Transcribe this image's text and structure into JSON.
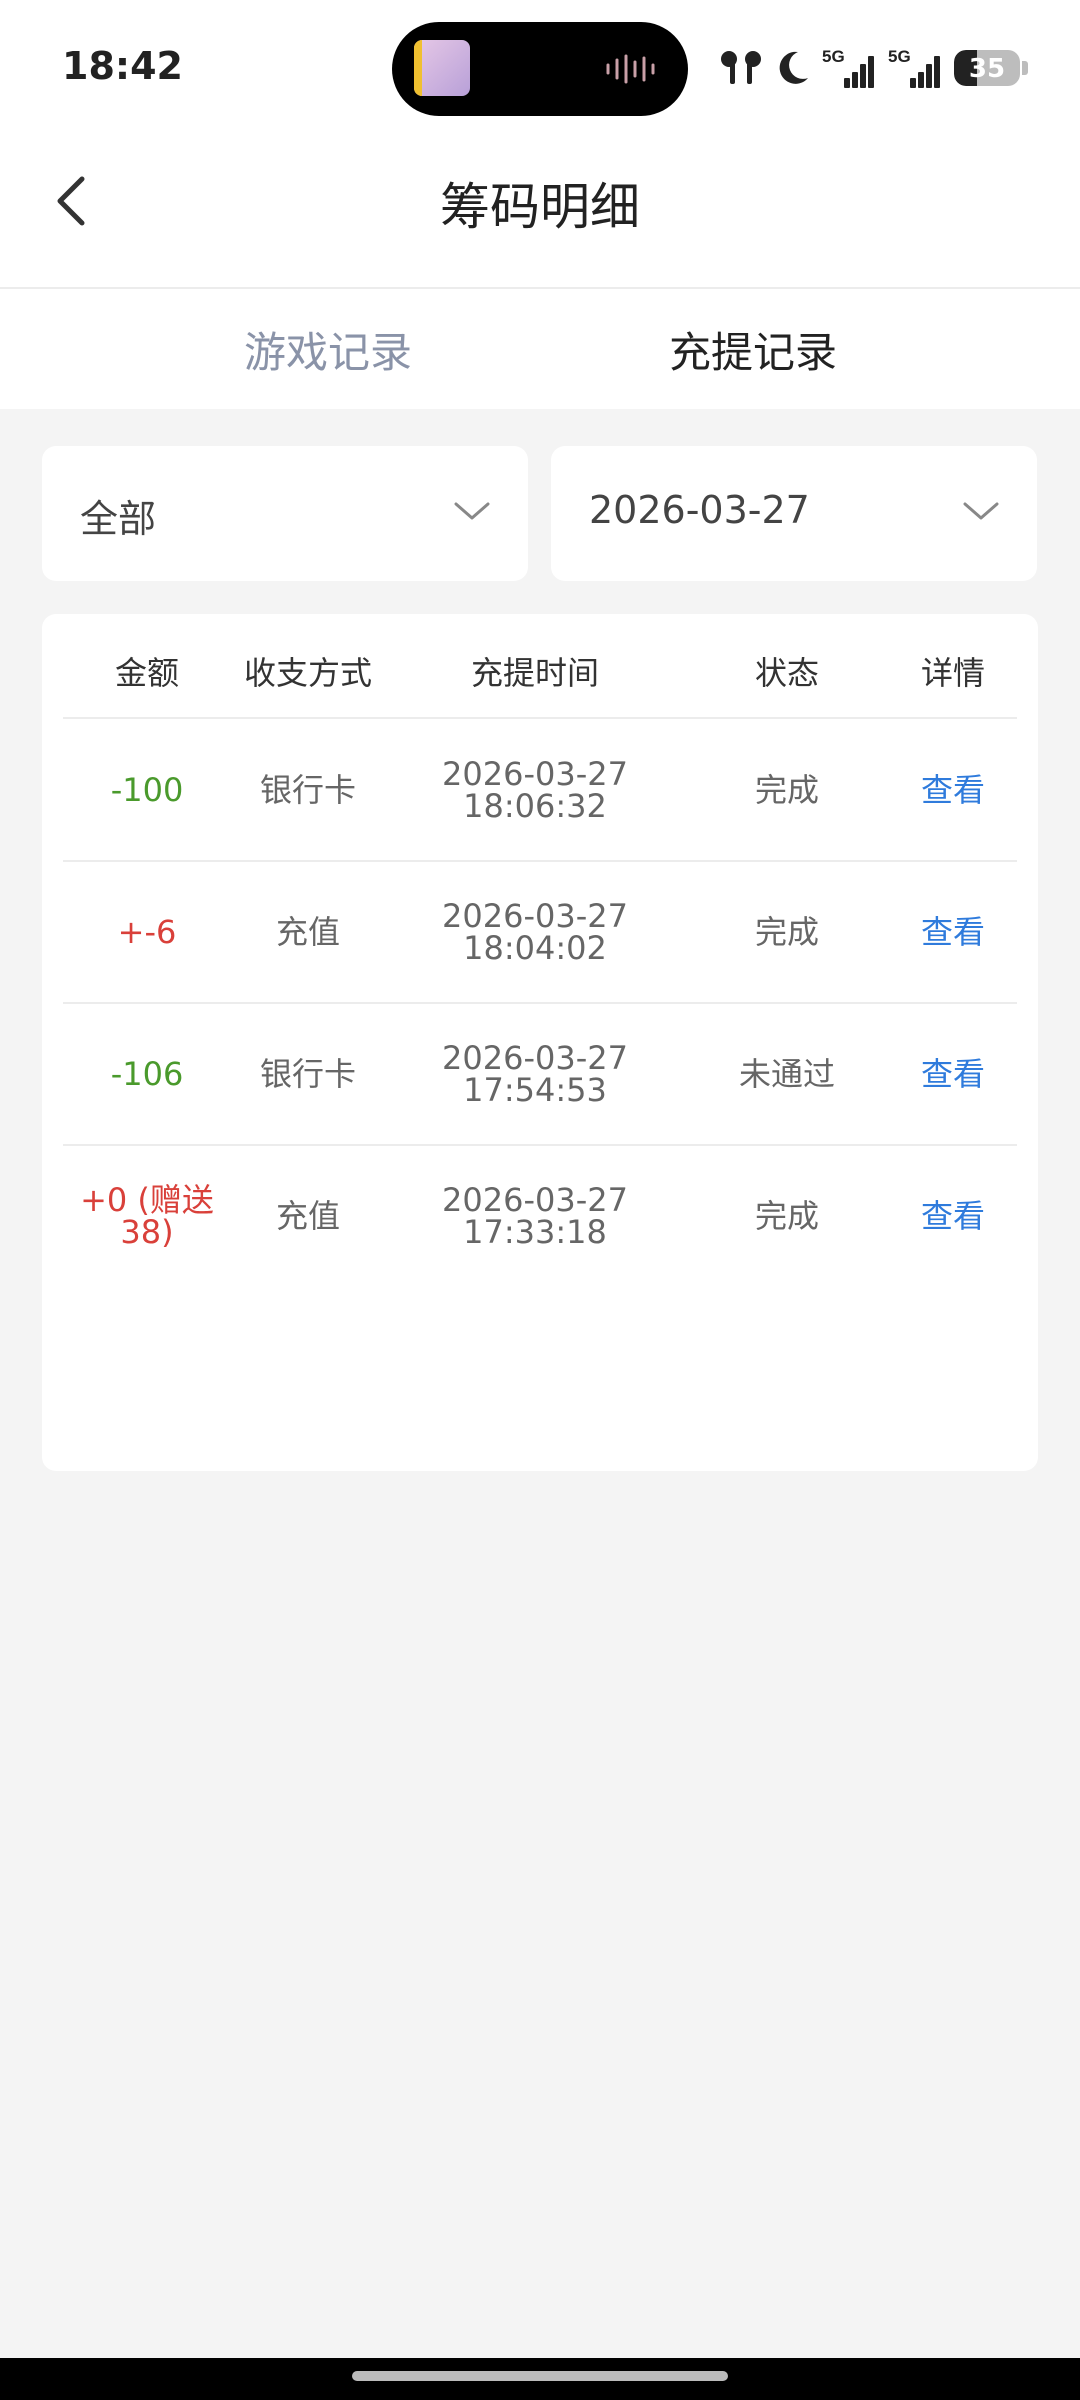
{
  "status_bar": {
    "time": "18:42",
    "signal_label_1": "5G",
    "signal_label_2": "5G",
    "battery_level": "35",
    "battery_fraction": 0.35
  },
  "header": {
    "title": "筹码明细"
  },
  "tabs": [
    {
      "label": "游戏记录",
      "active": false
    },
    {
      "label": "充提记录",
      "active": true
    }
  ],
  "filters": {
    "type": "全部",
    "date": "2026-03-27"
  },
  "table": {
    "headers": [
      "金额",
      "收支方式",
      "充提时间",
      "状态",
      "详情"
    ],
    "rows": [
      {
        "amount": "-100",
        "method": "银行卡",
        "date": "2026-03-27",
        "time": "18:06:32",
        "status": "完成",
        "detail": "查看",
        "color": "#4a9a2c"
      },
      {
        "amount": "+-6",
        "method": "充值",
        "date": "2026-03-27",
        "time": "18:04:02",
        "status": "完成",
        "detail": "查看",
        "color": "#d9403a"
      },
      {
        "amount": "-106",
        "method": "银行卡",
        "date": "2026-03-27",
        "time": "17:54:53",
        "status": "未通过",
        "detail": "查看",
        "color": "#4a9a2c"
      },
      {
        "amount": "+0 (赠送38)",
        "method": "充值",
        "date": "2026-03-27",
        "time": "17:33:18",
        "status": "完成",
        "detail": "查看",
        "color": "#d9403a"
      }
    ]
  },
  "icons": {
    "back": "back-arrow-icon",
    "chevron": "chevron-down-icon",
    "earbuds": "earbuds-icon",
    "moon": "moon-icon",
    "signal": "signal-icon",
    "battery": "battery-icon"
  },
  "colors": {
    "accent_link": "#2f7bdc",
    "negative": "#4a9a2c",
    "positive": "#d9403a",
    "inactive_tab": "#8a93a8"
  }
}
